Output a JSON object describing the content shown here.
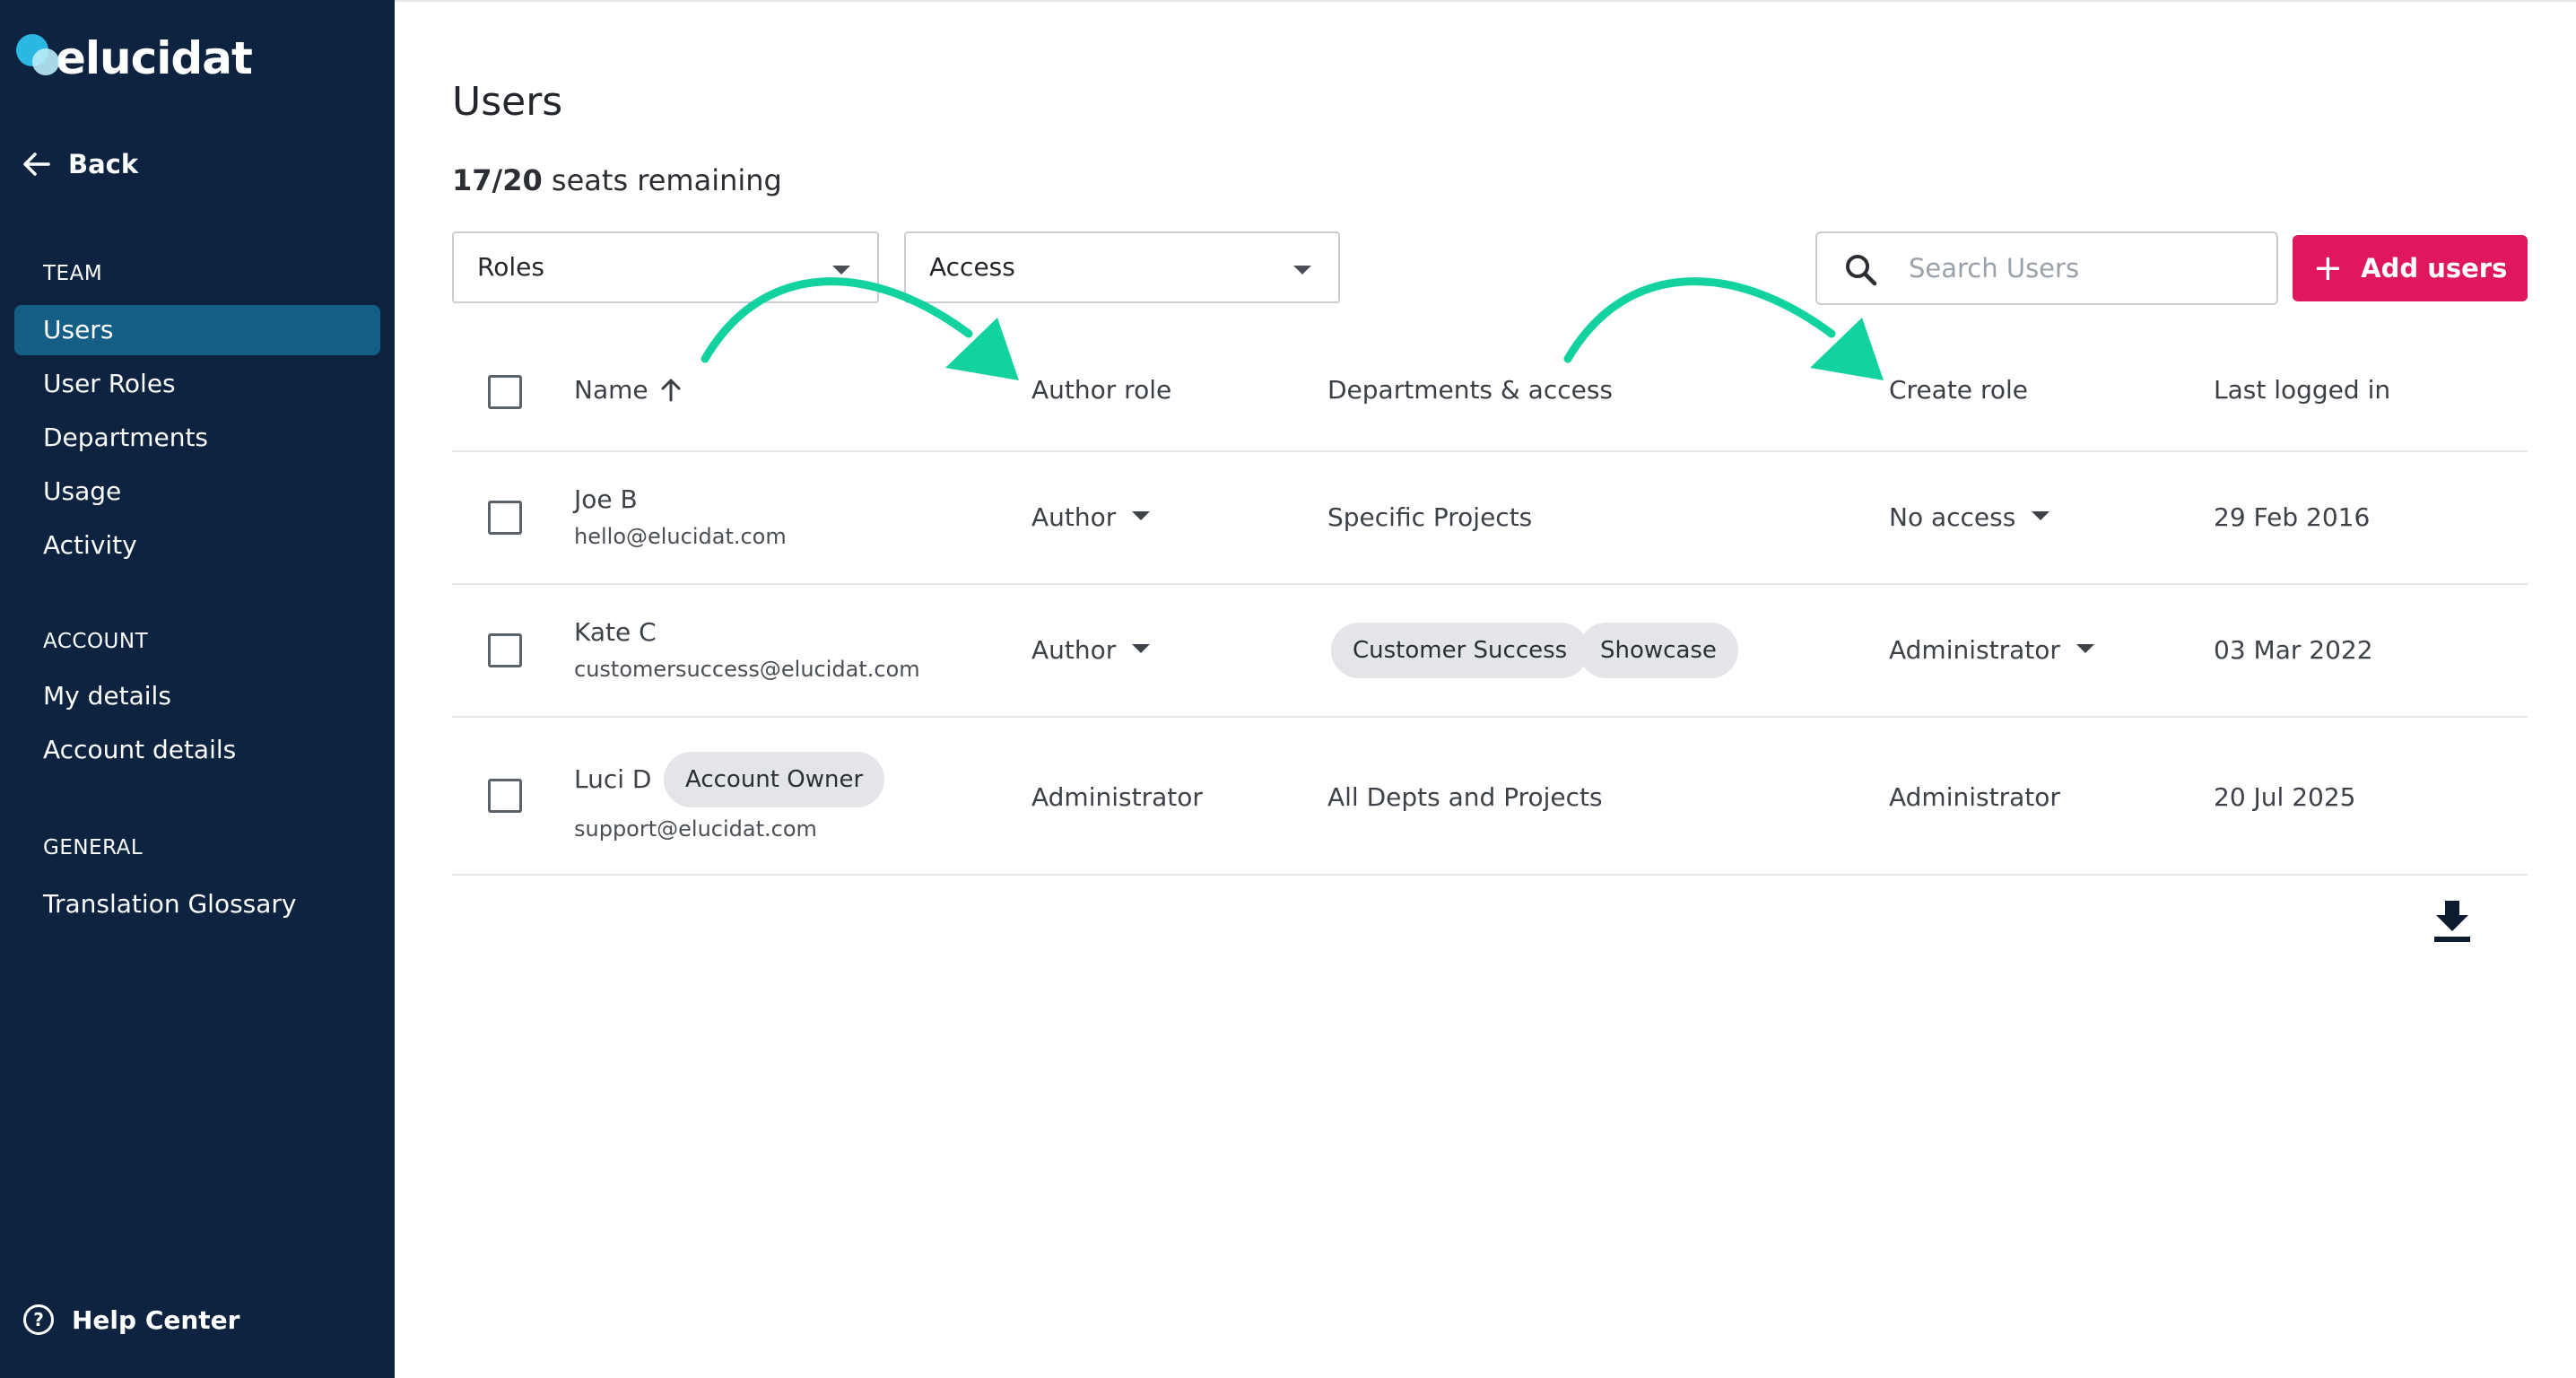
{
  "brand": {
    "name": "elucidat",
    "accent": "#e0175f",
    "sidebar_bg": "#0d2340",
    "active_bg": "#155e86",
    "annotation_arrow": "#12d3a0"
  },
  "sidebar": {
    "back_label": "Back",
    "sections": [
      {
        "label": "TEAM",
        "items": [
          "Users",
          "User Roles",
          "Departments",
          "Usage",
          "Activity"
        ]
      },
      {
        "label": "ACCOUNT",
        "items": [
          "My details",
          "Account details"
        ]
      },
      {
        "label": "GENERAL",
        "items": [
          "Translation Glossary"
        ]
      }
    ],
    "active_item": "Users",
    "help_label": "Help Center"
  },
  "main": {
    "title": "Users",
    "seats_count": "17/20",
    "seats_text": "seats remaining",
    "filters": {
      "roles": "Roles",
      "access": "Access"
    },
    "search": {
      "placeholder": "Search Users",
      "value": ""
    },
    "add_users_label": "Add users",
    "table": {
      "headers": {
        "name": "Name",
        "author_role": "Author role",
        "departments": "Departments & access",
        "create_role": "Create role",
        "last_logged_in": "Last logged in"
      },
      "sort": {
        "column": "Name",
        "direction": "ascending"
      },
      "rows": [
        {
          "name": "Joe B",
          "email": "hello@elucidat.com",
          "author_role": "Author",
          "author_dropdown": true,
          "departments_text": "Specific Projects",
          "departments_chips": [],
          "create_role": "No access",
          "create_dropdown": true,
          "last_logged_in": "29 Feb 2016",
          "badge": ""
        },
        {
          "name": "Kate C",
          "email": "customersuccess@elucidat.com",
          "author_role": "Author",
          "author_dropdown": true,
          "departments_text": "",
          "departments_chips": [
            "Customer Success",
            "Showcase"
          ],
          "create_role": "Administrator",
          "create_dropdown": true,
          "last_logged_in": "03 Mar 2022",
          "badge": ""
        },
        {
          "name": "Luci D",
          "email": "support@elucidat.com",
          "author_role": "Administrator",
          "author_dropdown": false,
          "departments_text": "All Depts and Projects",
          "departments_chips": [],
          "create_role": "Administrator",
          "create_dropdown": false,
          "last_logged_in": "20 Jul 2025",
          "badge": "Account Owner"
        }
      ]
    }
  }
}
